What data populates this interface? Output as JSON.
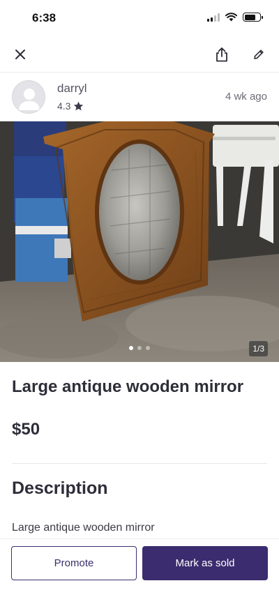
{
  "status_bar": {
    "time": "6:38",
    "battery_level": 0.75
  },
  "nav": {
    "close_icon": "close-icon",
    "share_icon": "share-icon",
    "edit_icon": "pencil-icon"
  },
  "seller": {
    "name": "darryl",
    "rating": "4.3",
    "posted": "4 wk  ago"
  },
  "listing": {
    "photo_counter": "1/3",
    "photo_count": 3,
    "active_photo": 1,
    "title": "Large antique wooden mirror",
    "price": "$50",
    "description_heading": "Description",
    "description": "Large antique wooden mirror"
  },
  "actions": {
    "promote_label": "Promote",
    "mark_sold_label": "Mark as sold"
  },
  "colors": {
    "brand_purple": "#3b2c6f",
    "text_dark": "#2e2e3a"
  }
}
